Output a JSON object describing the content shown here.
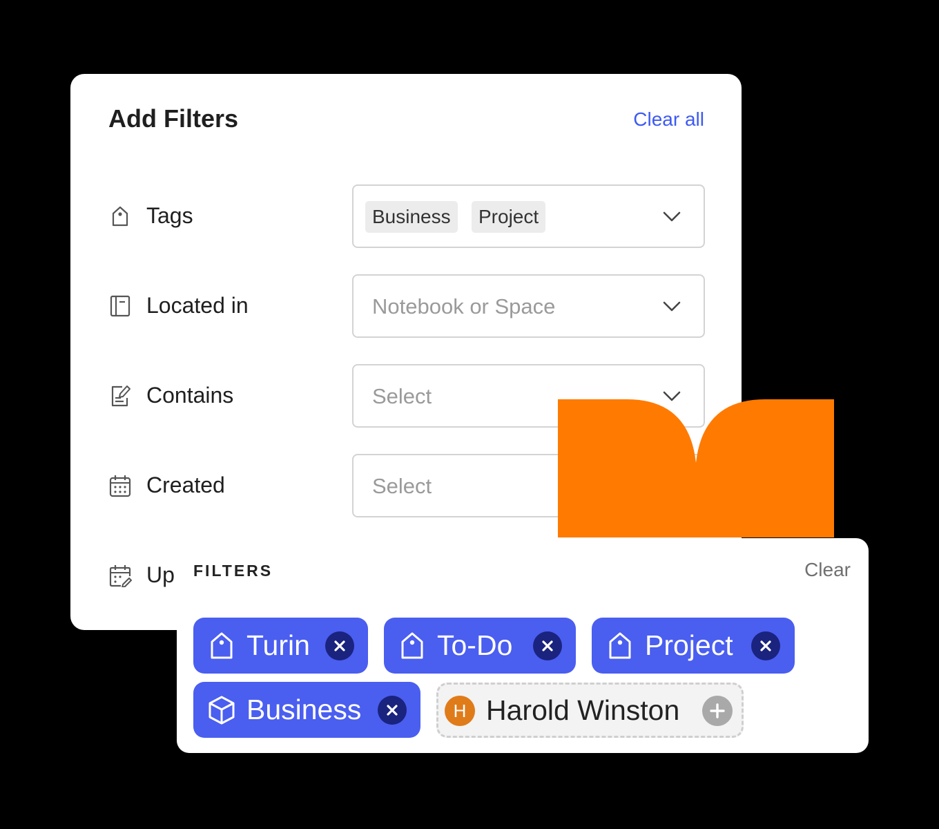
{
  "colors": {
    "accent": "#3d5af1",
    "chip_blue": "#4a5ef0",
    "chip_close": "#1a237e",
    "orange": "#ff7a00",
    "avatar": "#e07b1a"
  },
  "add_filters": {
    "title": "Add Filters",
    "clear_all_label": "Clear all",
    "rows": [
      {
        "icon": "tag-icon",
        "label": "Tags",
        "selected_tags": [
          "Business",
          "Project"
        ]
      },
      {
        "icon": "notebook-icon",
        "label": "Located in",
        "placeholder": "Notebook or Space"
      },
      {
        "icon": "note-edit-icon",
        "label": "Contains",
        "placeholder": "Select"
      },
      {
        "icon": "calendar-icon",
        "label": "Created",
        "placeholder": "Select"
      },
      {
        "icon": "calendar-edit-icon",
        "label": "Up"
      }
    ]
  },
  "filters_panel": {
    "title": "FILTERS",
    "clear_label": "Clear",
    "chips": [
      {
        "icon": "tag-icon",
        "label": "Turin"
      },
      {
        "icon": "tag-icon",
        "label": "To-Do"
      },
      {
        "icon": "tag-icon",
        "label": "Project"
      },
      {
        "icon": "cube-icon",
        "label": "Business"
      }
    ],
    "person_chip": {
      "avatar_initial": "H",
      "label": "Harold Winston"
    }
  }
}
